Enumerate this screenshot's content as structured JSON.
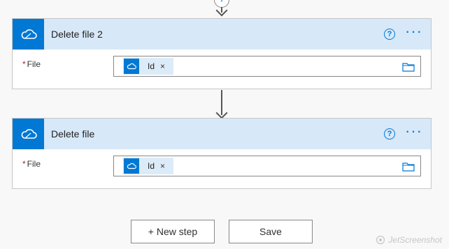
{
  "steps": [
    {
      "title": "Delete file 2",
      "field_label": "File",
      "required_mark": "*",
      "token": {
        "label": "Id",
        "remove": "×"
      }
    },
    {
      "title": "Delete file",
      "field_label": "File",
      "required_mark": "*",
      "token": {
        "label": "Id",
        "remove": "×"
      }
    }
  ],
  "help_label": "?",
  "more_label": "···",
  "footer": {
    "new_step_label": "+ New step",
    "save_label": "Save"
  },
  "watermark": "JetScreenshot",
  "icons": {
    "connector": "onedrive-cloud-icon",
    "add": "plus-icon",
    "folder": "folder-icon"
  },
  "colors": {
    "accent": "#0078d4",
    "header_bg": "#d7e8f9",
    "token_bg": "#dcebf8",
    "required": "#a4262c"
  }
}
